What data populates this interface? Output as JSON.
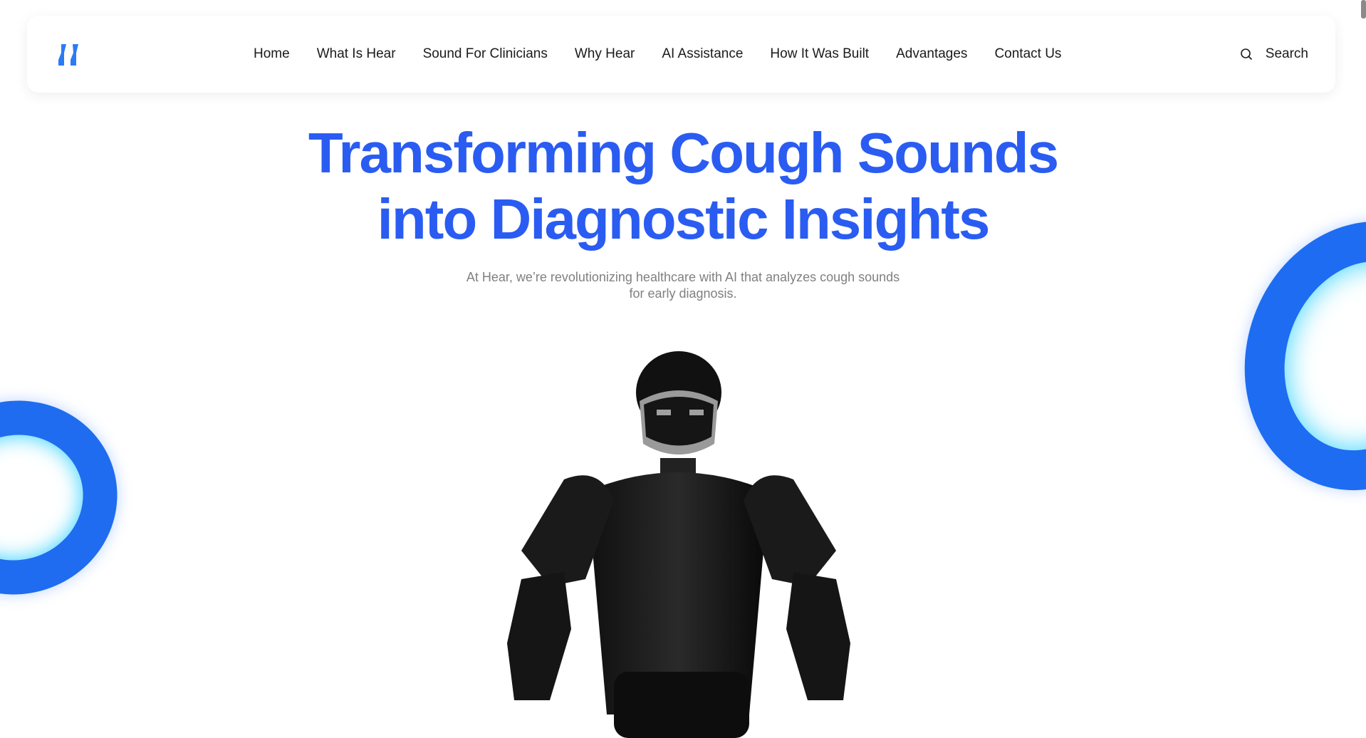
{
  "nav": {
    "logo": "Hear logo",
    "items": [
      "Home",
      "What Is Hear",
      "Sound For Clinicians",
      "Why Hear",
      "AI Assistance",
      "How It Was Built",
      "Advantages",
      "Contact Us"
    ],
    "search_label": "Search",
    "search_icon": "search-icon"
  },
  "hero": {
    "title_line1": "Transforming Cough Sounds",
    "title_line2": "into Diagnostic Insights",
    "subtitle_line1": "At Hear, we’re revolutionizing healthcare with AI that analyzes cough sounds",
    "subtitle_line2": "for early diagnosis."
  },
  "colors": {
    "accent": "#2a5cf2",
    "text": "#1b1b1b",
    "muted": "#808080"
  }
}
